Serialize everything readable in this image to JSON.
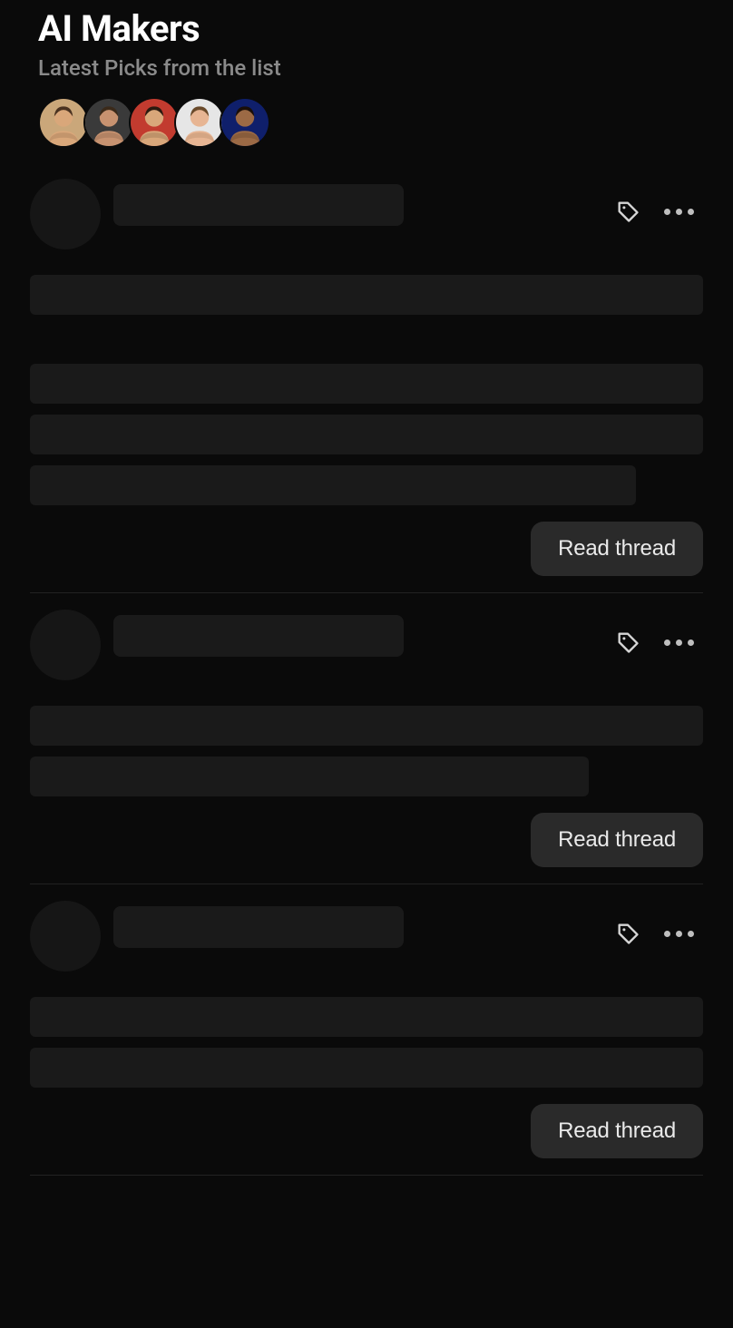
{
  "header": {
    "title": "AI Makers",
    "subtitle": "Latest Picks from the list"
  },
  "avatars": [
    {
      "name": "avatar-1",
      "bg": "#caa77a",
      "skin": "#d9a77a",
      "hair": "#4a3220"
    },
    {
      "name": "avatar-2",
      "bg": "#3a3a3a",
      "skin": "#c79270",
      "hair": "#3b2a1a"
    },
    {
      "name": "avatar-3",
      "bg": "#c23b2f",
      "skin": "#d9a77a",
      "hair": "#2b1a10"
    },
    {
      "name": "avatar-4",
      "bg": "#e6e6e6",
      "skin": "#e7b593",
      "hair": "#6a4a2a"
    },
    {
      "name": "avatar-5",
      "bg": "#0f1f6b",
      "skin": "#9c6a45",
      "hair": "#1a0f08"
    }
  ],
  "feed": [
    {
      "read_label": "Read thread",
      "lines": [
        {
          "width": "100%"
        },
        {
          "gap": true
        },
        {
          "width": "100%"
        },
        {
          "width": "100%"
        },
        {
          "width": "90%"
        }
      ]
    },
    {
      "read_label": "Read thread",
      "lines": [
        {
          "width": "100%"
        },
        {
          "width": "83%"
        }
      ]
    },
    {
      "read_label": "Read thread",
      "lines": [
        {
          "width": "100%"
        },
        {
          "width": "100%"
        }
      ]
    }
  ]
}
